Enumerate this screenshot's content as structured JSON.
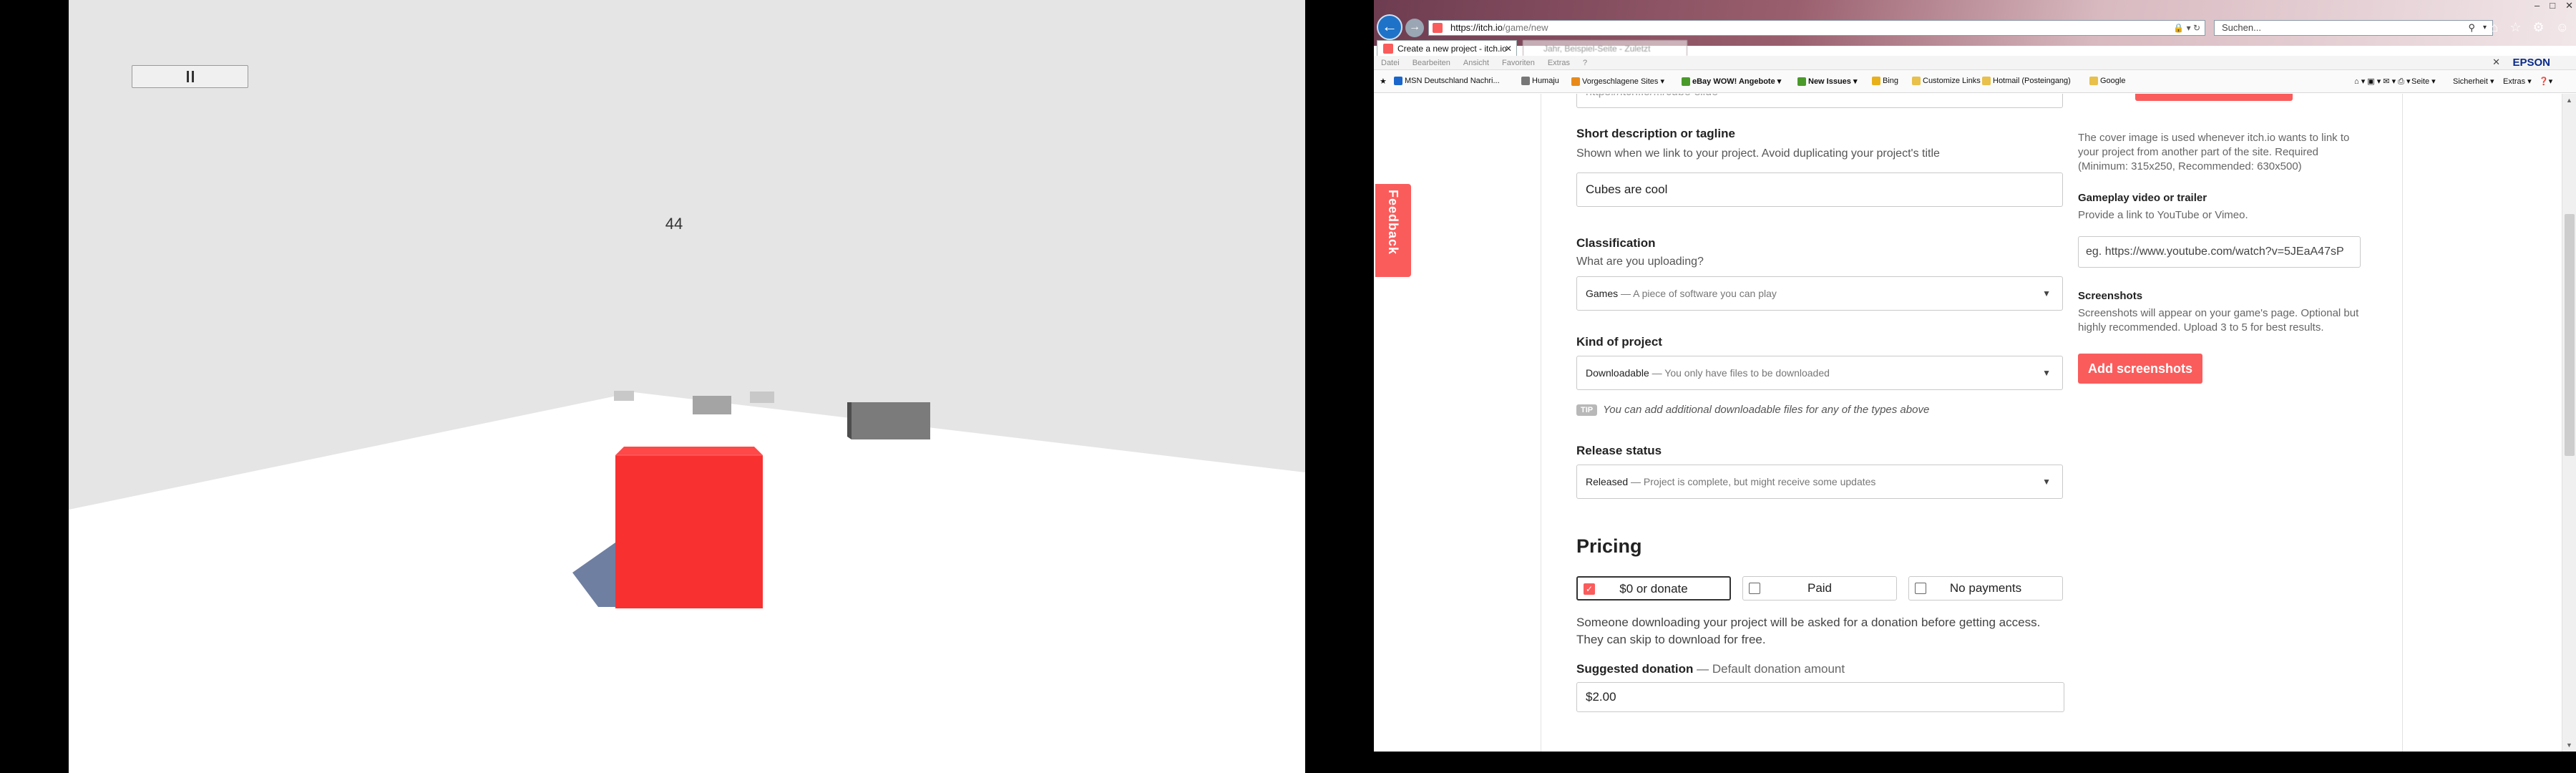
{
  "game": {
    "score": "44",
    "colors": {
      "sky": "#e5e5e5",
      "ground": "#ffffff",
      "cube": "#f83030",
      "cube_top": "#ff4848",
      "shadow": "#6f7fa2",
      "obstacle": "#7b7b7b"
    }
  },
  "browser": {
    "address": {
      "host": "https://itch.io",
      "path": "/game/new"
    },
    "search_placeholder": "Suchen...",
    "tabs": [
      {
        "label": "Create a new project - itch.io"
      },
      {
        "label": "Jahr, Beispiel-Seite - Zuletzt"
      }
    ],
    "menu": [
      "Datei",
      "Bearbeiten",
      "Ansicht",
      "Favoriten",
      "Extras",
      "?"
    ],
    "brand": "EPSON",
    "favorites": [
      {
        "label": "MSN Deutschland Nachri...",
        "color": "#1a66cc"
      },
      {
        "label": "Humaju",
        "color": "#777777"
      },
      {
        "label": "Vorgeschlagene Sites ▾",
        "color": "#e88a1a"
      },
      {
        "label": "eBay WOW! Angebote ▾",
        "color": "#4a9a2a"
      },
      {
        "label": "New Issues ▾",
        "color": "#4a9a2a"
      },
      {
        "label": "Bing",
        "color": "#e8b01a"
      },
      {
        "label": "Customize Links",
        "color": "#e8c04a"
      },
      {
        "label": "Hotmail (Posteingang)",
        "color": "#e8c04a"
      },
      {
        "label": "Google",
        "color": "#e8c04a"
      }
    ],
    "commands": [
      "Seite ▾",
      "Sicherheit ▾",
      "Extras ▾"
    ]
  },
  "page": {
    "feedback": "Feedback",
    "partial_field": "https://itch.io/.../cube-slide",
    "short_description": {
      "label": "Short description or tagline",
      "hint": "Shown when we link to your project. Avoid duplicating your project's title",
      "value": "Cubes are cool"
    },
    "classification": {
      "label": "Classification",
      "hint": "What are you uploading?",
      "value": "Games",
      "detail": "— A piece of software you can play"
    },
    "kind": {
      "label": "Kind of project",
      "value": "Downloadable",
      "detail": "— You only have files to be downloaded"
    },
    "tip": {
      "badge": "TIP",
      "text": "You can add additional downloadable files for any of the types above"
    },
    "release": {
      "label": "Release status",
      "value": "Released",
      "detail": "— Project is complete, but might receive some updates"
    },
    "pricing": {
      "title": "Pricing",
      "options": [
        {
          "label": "$0 or donate",
          "selected": true
        },
        {
          "label": "Paid",
          "selected": false
        },
        {
          "label": "No payments",
          "selected": false
        }
      ],
      "note": "Someone downloading your project will be asked for a donation before getting access. They can skip to download for free.",
      "donation_label": "Suggested donation",
      "donation_hint": "— Default donation amount",
      "donation_value": "$2.00"
    },
    "sidebar": {
      "cover_note": "The cover image is used whenever itch.io wants to link to your project from another part of the site. Required (Minimum: 315x250, Recommended: 630x500)",
      "video_label": "Gameplay video or trailer",
      "video_hint": "Provide a link to YouTube or Vimeo.",
      "video_placeholder": "eg. https://www.youtube.com/watch?v=5JEaA47sP",
      "screenshots_label": "Screenshots",
      "screenshots_hint": "Screenshots will appear on your game's page. Optional but highly recommended. Upload 3 to 5 for best results.",
      "screenshots_button": "Add screenshots"
    }
  }
}
